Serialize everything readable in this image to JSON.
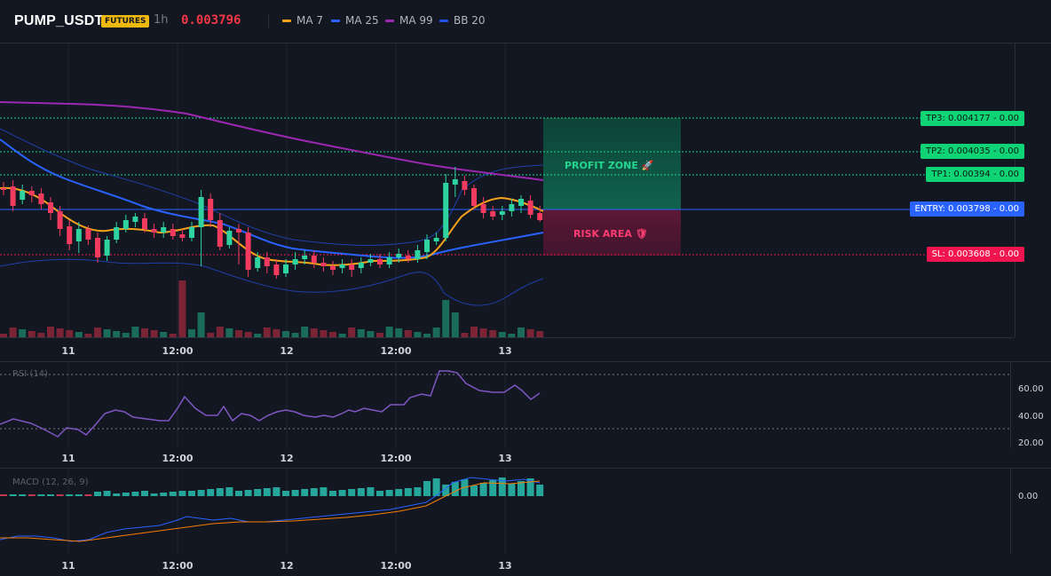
{
  "header": {
    "symbol": "PUMP_USDT",
    "market_badge": "FUTURES",
    "timeframe": "1h",
    "last_price": "0.003796"
  },
  "indicators_legend": [
    {
      "label": "MA 7",
      "color": "#f7a21b"
    },
    {
      "label": "MA 25",
      "color": "#2962ff"
    },
    {
      "label": "MA 99",
      "color": "#9c27b0"
    },
    {
      "label": "BB 20",
      "color": "#1e53e5"
    }
  ],
  "levels": {
    "tp3": {
      "label": "TP3: 0.004177",
      "pct": "0.00",
      "price": 0.004177
    },
    "tp2": {
      "label": "TP2: 0.004035",
      "pct": "0.00",
      "price": 0.004035
    },
    "tp1": {
      "label": "TP1: 0.00394",
      "pct": "0.00",
      "price": 0.00394
    },
    "entry": {
      "label": "ENTRY: 0.003798",
      "pct": "0.00",
      "price": 0.003798
    },
    "sl": {
      "label": "SL: 0.003608",
      "pct": "0.00",
      "price": 0.003608
    }
  },
  "zones": {
    "profit": "PROFIT ZONE 🚀",
    "risk": "RISK AREA 🛡"
  },
  "time_axis": [
    "11",
    "12:00",
    "12",
    "12:00",
    "13"
  ],
  "rsi": {
    "title": "RSI (14)",
    "axis": [
      "60.00",
      "40.00",
      "20.00"
    ]
  },
  "macd": {
    "title": "MACD (12, 26, 9)",
    "axis": [
      "0.00"
    ]
  },
  "colors": {
    "background": "#131722",
    "up": "#2ed3a0",
    "down": "#f23b5e",
    "tp_green": "#1dd68a",
    "entry_blue": "#2962ff",
    "sl_red": "#f0154f",
    "rsi_line": "#7e57c2"
  }
}
